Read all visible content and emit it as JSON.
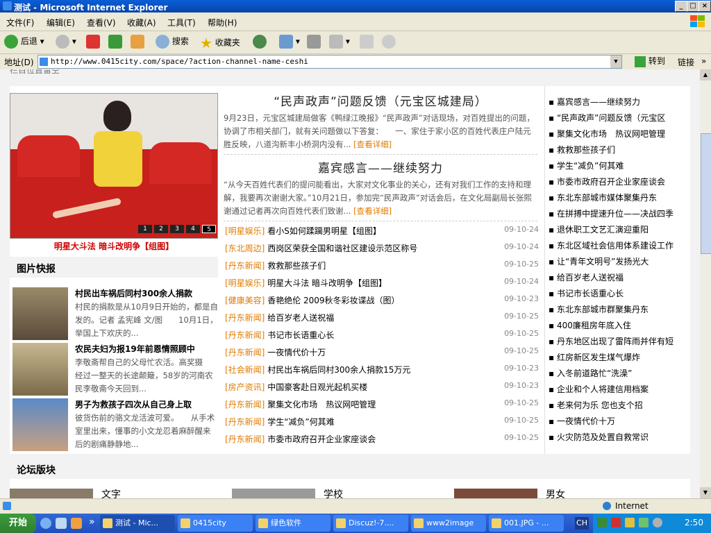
{
  "window": {
    "title": "测试 - Microsoft Internet Explorer",
    "buttons": [
      "_",
      "□",
      "×"
    ]
  },
  "menu": [
    "文件(F)",
    "编辑(E)",
    "查看(V)",
    "收藏(A)",
    "工具(T)",
    "帮助(H)"
  ],
  "toolbar": {
    "back": "后退",
    "search": "搜索",
    "favorites": "收藏夹"
  },
  "address": {
    "label": "地址(D)",
    "url": "http://www.0415city.com/space/?action-channel-name-ceshi",
    "go": "转到",
    "links": "链接"
  },
  "page": {
    "breadcrumb": "栏目位置留空",
    "featured_caption": "明星大斗法 暗斗改明争【组图】",
    "slide_numbers": [
      "1",
      "2",
      "3",
      "4",
      "5"
    ],
    "photo_news_title": "图片快报",
    "forum_title": "论坛版块",
    "forum_items": [
      "文字",
      "学校",
      "男女"
    ],
    "more_label": "[查看详细]",
    "stories": [
      {
        "title": "“民声政声”问题反馈（元宝区城建局）",
        "body": "9月23日，元宝区城建局做客《鸭绿江晚报》“民声政声”对话现场，对百姓提出的问题，协调了市相关部门，就有关问题做以下答复：　　一、家住于家小区的百姓代表庄户陆元胜反映，八道沟新丰小桥洞内没有..."
      },
      {
        "title": "嘉宾感言——继续努力",
        "body": "“从今天百姓代表们的提问能看出，大家对文化事业的关心，还有对我们工作的支持和理解，我要再次谢谢大家。”10月21日，参加完“民声政声”对话会后，在文化局副局长张熙谢通过记者再次向百姓代表们致谢..."
      }
    ],
    "news": [
      {
        "cat": "[明星娱乐]",
        "title": "看小S如何蹂躏男明星【组图】",
        "date": "09-10-24"
      },
      {
        "cat": "[东北周边]",
        "title": "西岗区荣获全国和谐社区建设示范区称号",
        "date": "09-10-24"
      },
      {
        "cat": "[丹东新闻]",
        "title": "救救那些孩子们",
        "date": "09-10-25"
      },
      {
        "cat": "[明星娱乐]",
        "title": "明星大斗法 暗斗改明争【组图】",
        "date": "09-10-24"
      },
      {
        "cat": "[健康美容]",
        "title": "香艳绝伦 2009秋冬彩妆谍战（图）",
        "date": "09-10-23"
      },
      {
        "cat": "[丹东新闻]",
        "title": "给百岁老人送祝福",
        "date": "09-10-25"
      },
      {
        "cat": "[丹东新闻]",
        "title": "书记市长语重心长",
        "date": "09-10-25"
      },
      {
        "cat": "[丹东新闻]",
        "title": "一夜情代价十万",
        "date": "09-10-25"
      },
      {
        "cat": "[社会新闻]",
        "title": "村民出车祸后同村300余人捐款15万元",
        "date": "09-10-23"
      },
      {
        "cat": "[房产资讯]",
        "title": "中国豪客赴日观光起机买楼",
        "date": "09-10-23"
      },
      {
        "cat": "[丹东新闻]",
        "title": "聚集文化市场　热议网吧管理",
        "date": "09-10-25"
      },
      {
        "cat": "[丹东新闻]",
        "title": "学生“减负”何其难",
        "date": "09-10-25"
      },
      {
        "cat": "[丹东新闻]",
        "title": "市委市政府召开企业家座谈会",
        "date": "09-10-25"
      }
    ],
    "right_list": [
      "嘉宾感言——继续努力",
      "“民声政声”问题反馈（元宝区",
      "聚集文化市场　热议网吧管理",
      "救救那些孩子们",
      "学生“减负”何其难",
      "市委市政府召开企业家座谈会",
      "东北东部城市媒体聚集丹东",
      "在拼搏中提速升位——决战四季",
      "退休职工文艺汇演迎重阳",
      "东北区域社会信用体系建设工作",
      "让“青年文明号”发扬光大",
      "给百岁老人送祝福",
      "书记市长语重心长",
      "东北东部城市群聚集丹东",
      "400廉租房年底入住",
      "丹东地区出现了雷阵雨并伴有短",
      "红房新区发生煤气爆炸",
      "入冬前道路忙“洗澡”",
      "企业和个人将建信用档案",
      "老来何为乐 您也支个招",
      "一夜情代价十万",
      "火灾防范及处置自救常识"
    ],
    "photo_news": [
      {
        "title": "村民出车祸后同村300余人捐款",
        "desc": "村民的捐款是从10月9日开始的，都是自发的。记者 孟宪峰 文/图　　10月1日，举国上下欢庆的..."
      },
      {
        "title": "农民夫妇为报19年前恩情照顾中",
        "desc": "李敬斋帮自己的父母忙农活。高奖摄　经过一整天的长途颠簸，58岁的河南农民李敬斋今天回到..."
      },
      {
        "title": "男子为救孩子四次从自己身上取",
        "desc": "彼货伤前的骆文龙活波可爱。　　从手术室里出来，懂事的小文龙忍着麻醉醒来后的剧痛静静地..."
      }
    ]
  },
  "status": {
    "zone": "Internet"
  },
  "taskbar": {
    "start": "开始",
    "tasks": [
      "测试 - Mic...",
      "0415city",
      "绿色软件",
      "Discuz!-7....",
      "www2image",
      "001.JPG - ..."
    ],
    "lang": "CH",
    "clock": "2:50"
  }
}
